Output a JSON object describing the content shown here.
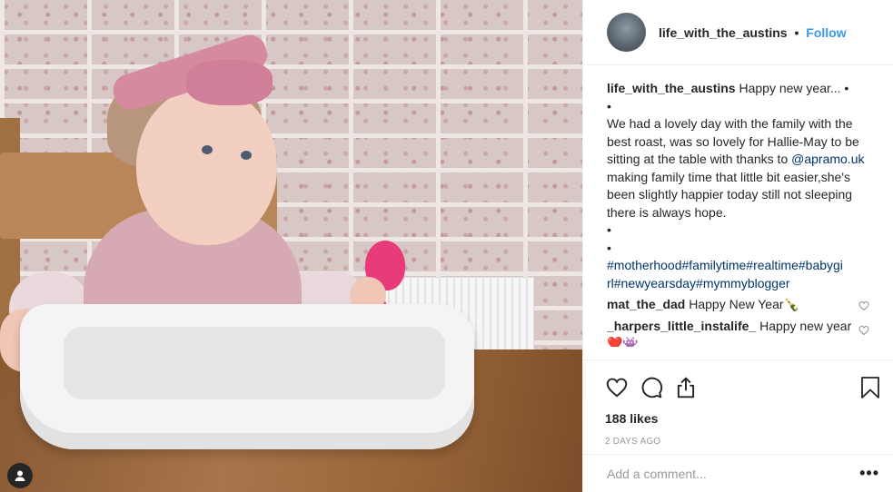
{
  "post": {
    "username": "life_with_the_austins",
    "separator": "•",
    "follow_label": "Follow",
    "accent_color": "#3897f0"
  },
  "caption": {
    "username": "life_with_the_austins",
    "line1": "Happy new year... •",
    "line2": "•",
    "body_pre": "We had a lovely day with the family with the best roast, was so lovely for Hallie-May to be sitting at the table with thanks to ",
    "mention": "@apramo.uk",
    "body_post": " making family time that little bit easier,she's been slightly happier today still not sleeping there is always hope.",
    "line4": "•",
    "line5": "•",
    "hashtags_1": "#motherhood#familytime#realtime#babygi",
    "hashtags_2": "rl#newyearsday#mymmyblogger"
  },
  "comments": [
    {
      "username": "mat_the_dad",
      "text": "Happy New Year🍾",
      "icon": "heart-outline-icon"
    },
    {
      "username": "_harpers_little_instalife_",
      "text": "Happy new year ❤️👾",
      "icon": "heart-outline-icon"
    }
  ],
  "engagement": {
    "likes": "188 likes",
    "date": "2 DAYS AGO"
  },
  "add_comment": {
    "placeholder": "Add a comment...",
    "more": "•••"
  },
  "icons": {
    "like": "heart-icon",
    "comment": "comment-icon",
    "share": "share-icon",
    "save": "bookmark-icon",
    "tag": "user-tag-icon"
  }
}
